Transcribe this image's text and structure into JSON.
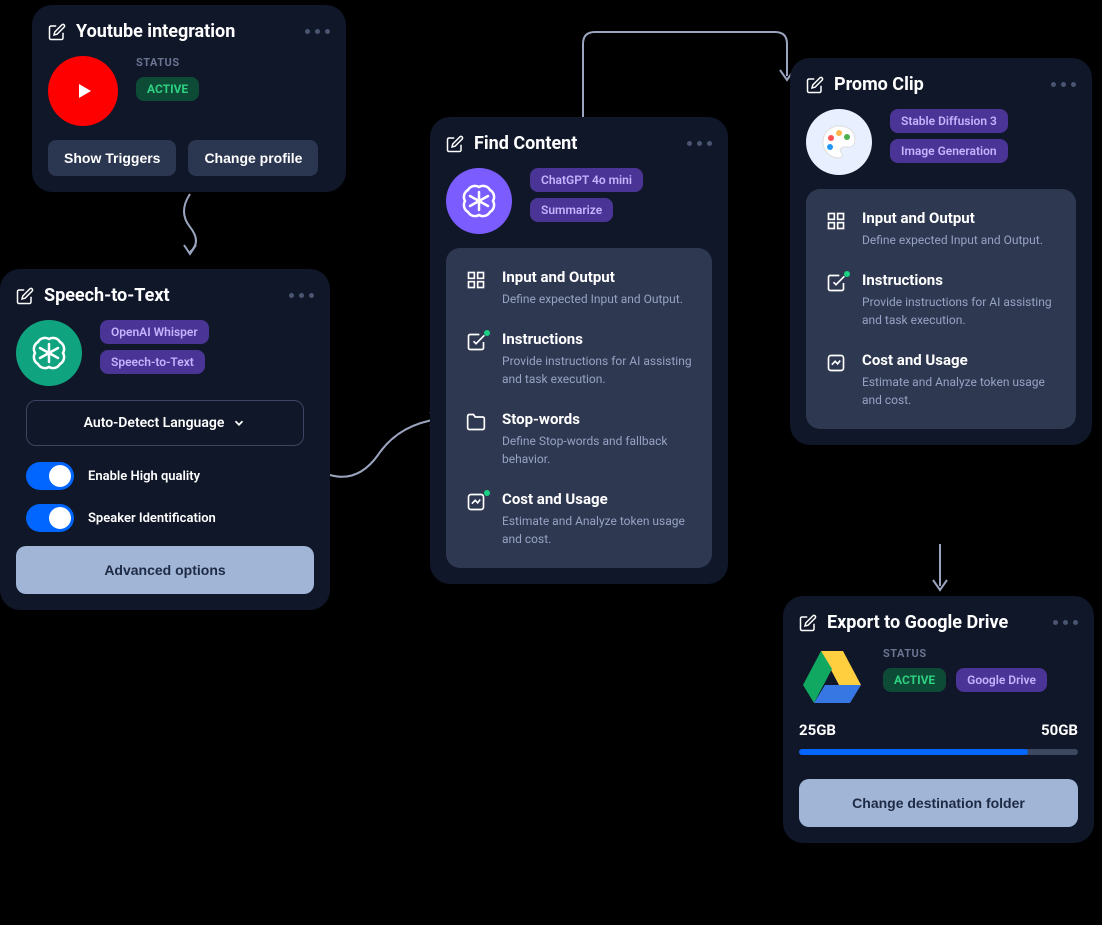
{
  "cards": {
    "youtube": {
      "title": "Youtube integration",
      "status_label": "STATUS",
      "status": "ACTIVE",
      "buttons": {
        "triggers": "Show Triggers",
        "profile": "Change profile"
      }
    },
    "speech": {
      "title": "Speech-to-Text",
      "tags": {
        "model": "OpenAI Whisper",
        "task": "Speech-to-Text"
      },
      "select": "Auto-Detect Language",
      "toggles": {
        "hq": "Enable High quality",
        "speaker": "Speaker Identification"
      },
      "advanced": "Advanced options"
    },
    "find": {
      "title": "Find Content",
      "tags": {
        "model": "ChatGPT 4o mini",
        "task": "Summarize"
      },
      "items": {
        "io": {
          "title": "Input and Output",
          "desc": "Define expected Input and Output."
        },
        "instructions": {
          "title": "Instructions",
          "desc": "Provide instructions for AI assisting and task execution."
        },
        "stopwords": {
          "title": "Stop-words",
          "desc": "Define Stop-words and fallback behavior."
        },
        "cost": {
          "title": "Cost and Usage",
          "desc": "Estimate and Analyze token usage and cost."
        }
      }
    },
    "promo": {
      "title": "Promo Clip",
      "tags": {
        "model": "Stable Diffusion 3",
        "task": "Image Generation"
      },
      "items": {
        "io": {
          "title": "Input and Output",
          "desc": "Define expected Input and Output."
        },
        "instructions": {
          "title": "Instructions",
          "desc": "Provide instructions for AI assisting and task execution."
        },
        "cost": {
          "title": "Cost and Usage",
          "desc": "Estimate and Analyze token usage and cost."
        }
      }
    },
    "drive": {
      "title": "Export to Google Drive",
      "status_label": "STATUS",
      "status": "ACTIVE",
      "tag": "Google Drive",
      "storage": {
        "used": "25GB",
        "total": "50GB",
        "pct": 82
      },
      "button": "Change destination folder"
    }
  }
}
